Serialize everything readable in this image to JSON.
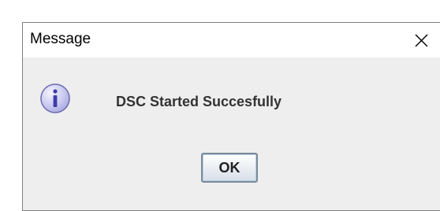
{
  "dialog": {
    "title": "Message",
    "message": "DSC Started Succesfully",
    "ok_label": "OK",
    "icon": "info-icon",
    "close_icon": "close-icon"
  },
  "colors": {
    "dialog_background": "#eeeeee",
    "titlebar_background": "#ffffff",
    "icon_fill": "#c8c8f0",
    "icon_border": "#6a6ab0"
  }
}
